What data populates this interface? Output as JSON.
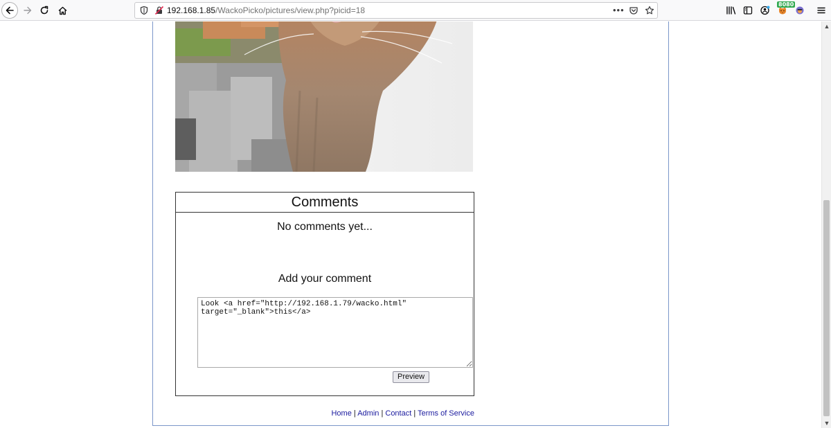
{
  "browser": {
    "url_host": "192.168.1.85",
    "url_path": "/WackoPicko/pictures/view.php?picid=18",
    "more_label": "•••",
    "proxy_badge": "8080"
  },
  "colors": {
    "frame_border": "#7a96c9",
    "link": "#1a1a9e"
  },
  "comments": {
    "title": "Comments",
    "empty_text": "No comments yet...",
    "add_label": "Add your comment",
    "textarea_value": "Look <a href=\"http://192.168.1.79/wacko.html\"\ntarget=\"_blank\">this</a>",
    "preview_label": "Preview"
  },
  "footer": {
    "home": "Home",
    "admin": "Admin",
    "contact": "Contact",
    "terms": "Terms of Service",
    "separator": " | "
  }
}
